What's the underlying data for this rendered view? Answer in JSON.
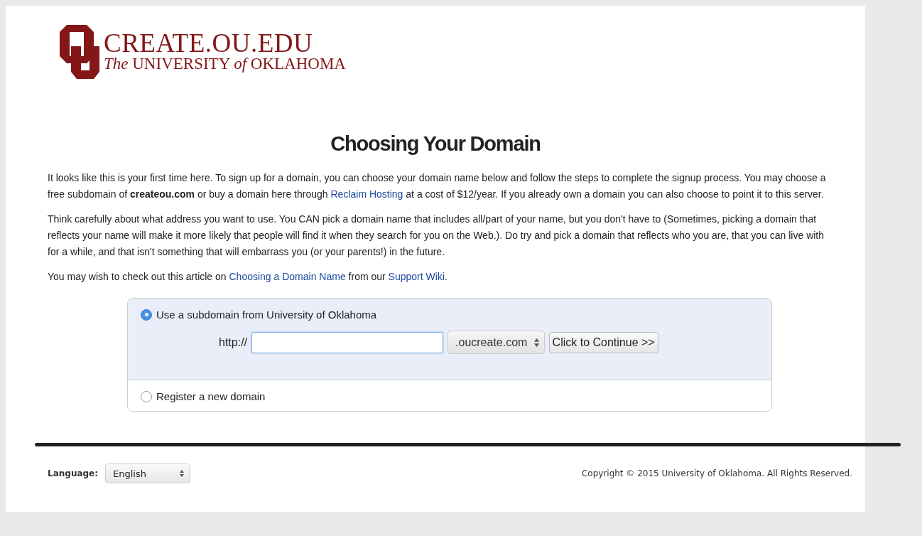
{
  "logo": {
    "title": "CREATE.OU.EDU",
    "subtitle": "*The* UNIVERSITY *of* OKLAHOMA"
  },
  "heading": "Choosing Your Domain",
  "paragraphs": [
    [
      {
        "text": "It looks like this is your first time here. To sign up for a domain, you can choose your domain name below and follow the steps to complete the signup process. You may choose a free subdomain of **createou.com** or buy a domain here through "
      },
      {
        "link": "Reclaim Hosting"
      },
      {
        "text": " at a cost of $12/year. If you already own a domain you can also choose to point it to this server."
      }
    ],
    [
      {
        "text": "Think carefully about what address you want to use. You CAN pick a domain name that includes all/part of your name, but you don't have to (Sometimes, picking a domain that reflects your name will make it more likely that people will find it when they search for you on the Web.). Do try and pick a domain that reflects who you are, that you can live with for a while, and that isn't something that will embarrass you (or your parents!) in the future."
      }
    ],
    [
      {
        "text": "You may wish to check out this article on "
      },
      {
        "link": "Choosing a Domain Name"
      },
      {
        "text": " from our "
      },
      {
        "link": "Support Wiki"
      },
      {
        "text": "."
      }
    ]
  ],
  "options": [
    {
      "label": "Use a subdomain from University of Oklahoma",
      "selected": true,
      "prefix": "http://",
      "suffix": ".oucreate.com",
      "button": "Click to Continue >>"
    },
    {
      "label": "Register a new domain",
      "selected": false
    }
  ],
  "footer": {
    "language_label": "Language:",
    "language": "English",
    "copyright": "Copyright © 2015 University of Oklahoma. All Rights Reserved."
  }
}
